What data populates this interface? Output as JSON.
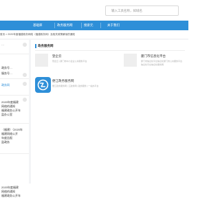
{
  "search": {
    "placeholder": "输入工具名称，如域名"
  },
  "nav": {
    "items": [
      "基础库",
      "政务服务网",
      "搜索元",
      "关于我们"
    ]
  },
  "breadcrumb": "首页 > 2020年度福建政务网络（福建政务网）及相关政策解读的通知",
  "sidebar": {
    "items": [
      {
        "title_lines": [
          "…"
        ],
        "meta": ""
      },
      {
        "title_lines": [
          "政务号…"
        ],
        "meta": ""
      },
      {
        "title_lines": [
          "服务号…"
        ],
        "meta": ""
      },
      {
        "title_lines": [
          "政务网"
        ],
        "meta": ""
      },
      {
        "title_lines": [
          "2020年度福建",
          "网络的通知",
          "福建政务公开年",
          "监办公室"
        ],
        "meta": ""
      },
      {
        "title_lines": [
          "（福建）（2020年",
          "福建网络公开",
          "年度告报",
          "监政务"
        ],
        "meta": ""
      },
      {
        "title_lines": [
          "2020年度福建",
          "网络的通知",
          "福建政务公开年"
        ],
        "meta": ""
      }
    ]
  },
  "main": {
    "section_title": "政务服务网",
    "cards": [
      {
        "title": "登企云",
        "desc_lines": [
          "登企云 | 厦门市中小企业公共服务平台"
        ]
      },
      {
        "title": "厦门市信息化平台",
        "desc_lines": [
          "厦门市信息化平台信息化厦门市公共服务平台",
          "信息化平台信息化服务网"
        ]
      },
      {
        "title": "便江政务服务网",
        "desc_lines": [
          "便江政务服务网 | 江政务网 | 政务服务 | 一站办平台"
        ]
      }
    ]
  },
  "colors": {
    "accent": "#2e8fd8",
    "page_bg": "#f3f4f6"
  }
}
